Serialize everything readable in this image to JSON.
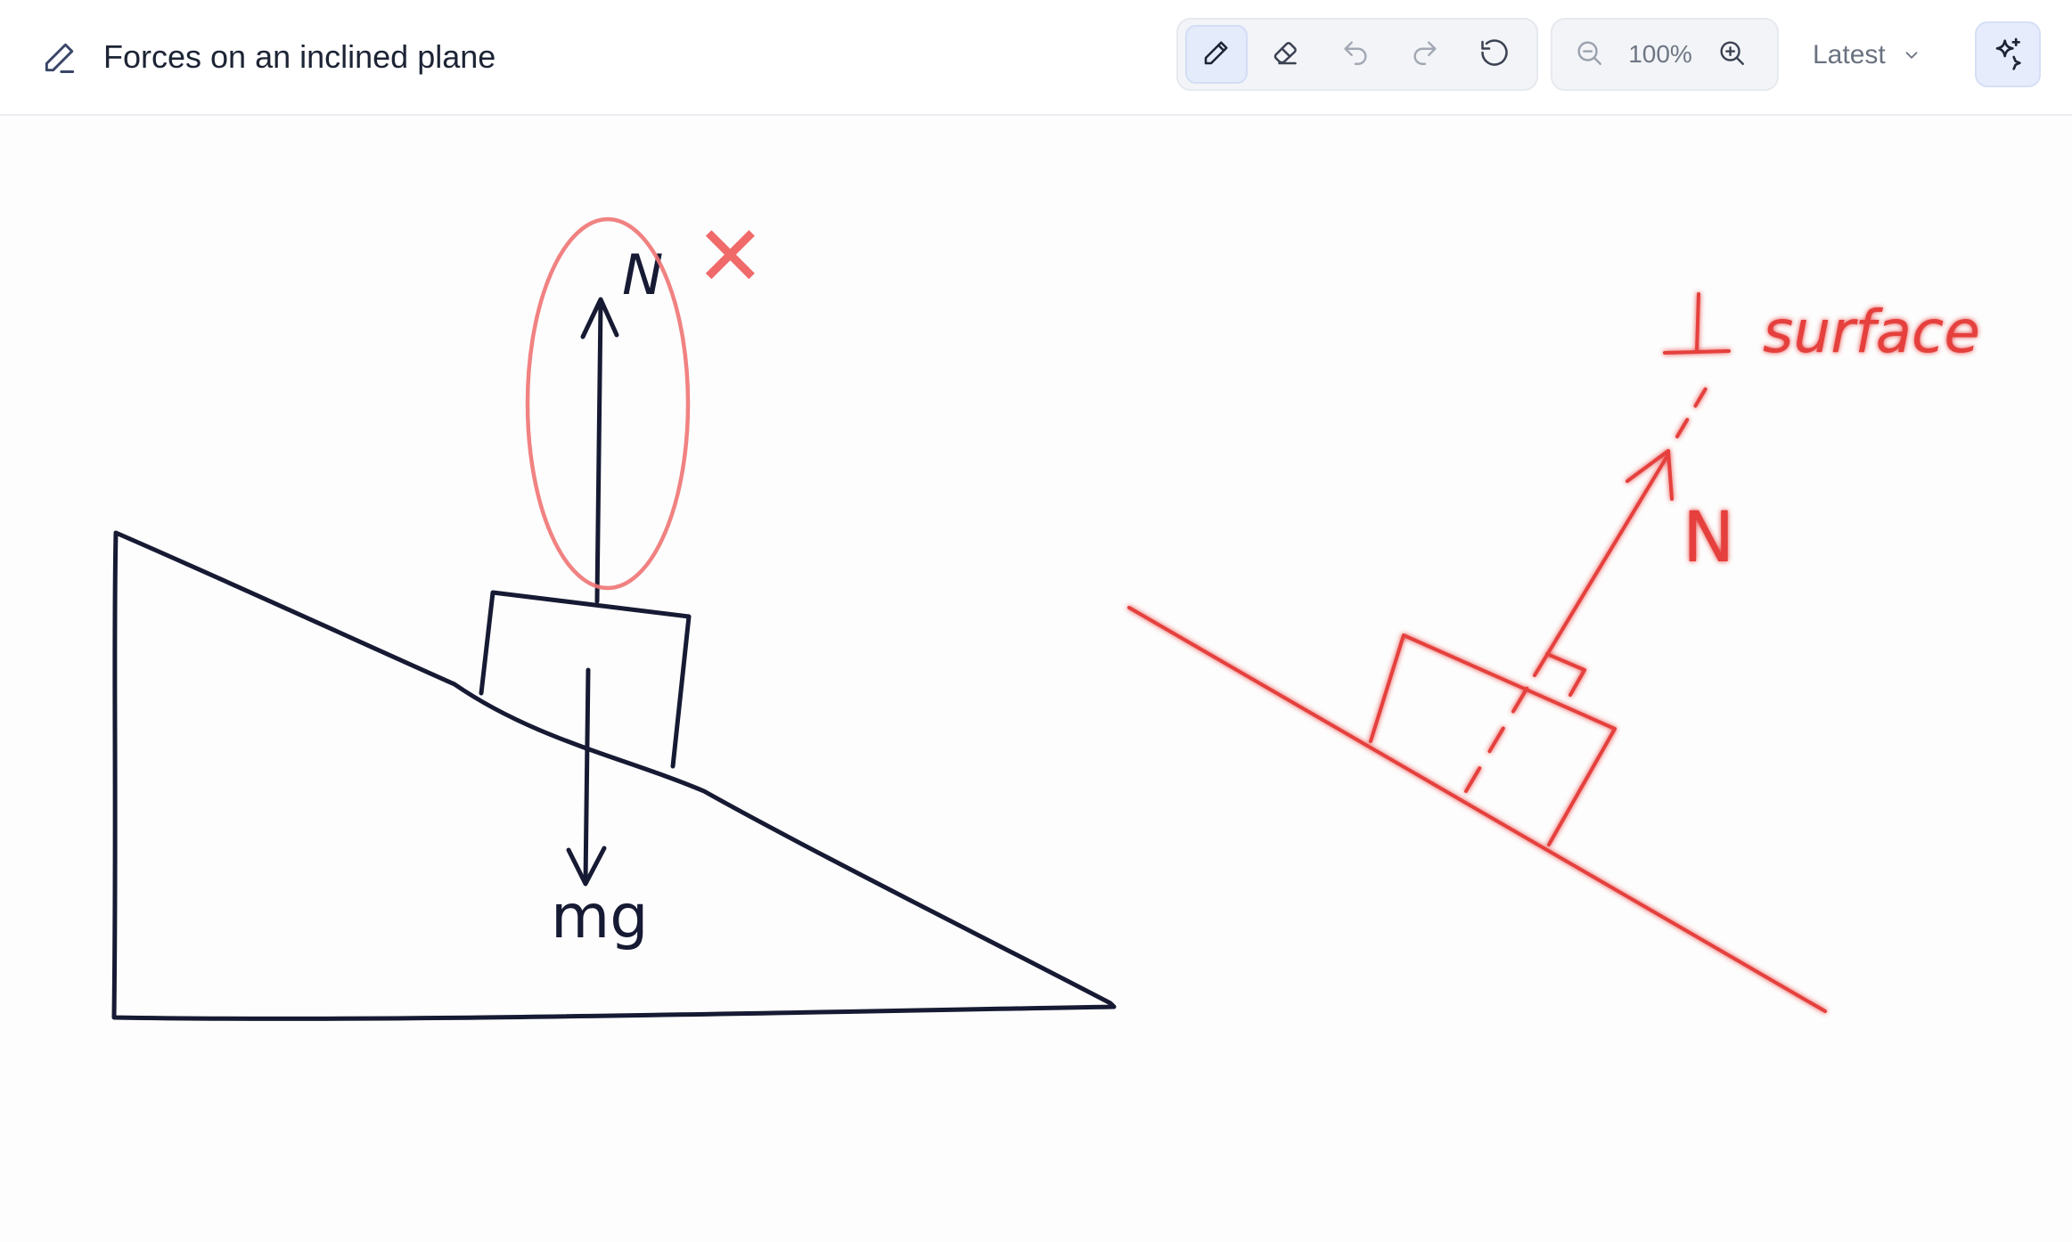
{
  "header": {
    "title": "Forces on an inclined plane",
    "zoom": "100%",
    "version_label": "Latest"
  },
  "toolbar": {
    "tools": [
      {
        "name": "pen",
        "icon": "pen-icon",
        "active": true
      },
      {
        "name": "eraser",
        "icon": "eraser-icon",
        "active": false
      },
      {
        "name": "undo",
        "icon": "undo-icon",
        "active": false
      },
      {
        "name": "redo",
        "icon": "redo-icon",
        "active": false
      },
      {
        "name": "reset",
        "icon": "reset-icon",
        "active": false
      }
    ],
    "zoom_controls": [
      "zoom-out-icon",
      "zoom-in-icon"
    ],
    "ai_button_icon": "sparkle-icon"
  },
  "canvas": {
    "left_diagram": {
      "normal_label": "N",
      "weight_label": "mg",
      "mark": "✕",
      "ink_color": "#161a33",
      "correction_color": "#f08080"
    },
    "right_diagram": {
      "perp_symbol": "⊥",
      "perp_word": "surface",
      "normal_label": "N",
      "ink_color": "#e5403d"
    }
  },
  "colors": {
    "accent": "#e4ebfb",
    "title_text": "#1d2435",
    "muted_text": "#6e7684"
  }
}
